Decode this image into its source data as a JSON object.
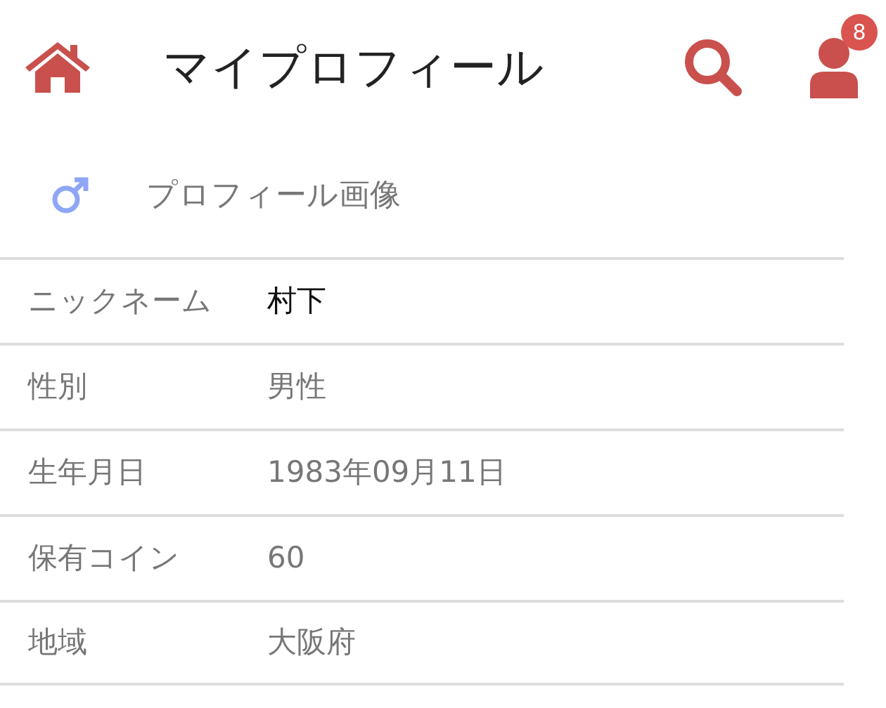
{
  "header": {
    "title": "マイプロフィール",
    "notification_count": "8"
  },
  "profile_image": {
    "label": "プロフィール画像"
  },
  "fields": [
    {
      "label": "ニックネーム",
      "value": "村下",
      "emphasized": true
    },
    {
      "label": "性別",
      "value": "男性",
      "emphasized": false
    },
    {
      "label": "生年月日",
      "value": "1983年09月11日",
      "emphasized": false
    },
    {
      "label": "保有コイン",
      "value": "60",
      "emphasized": false
    },
    {
      "label": "地域",
      "value": "大阪府",
      "emphasized": false
    }
  ]
}
